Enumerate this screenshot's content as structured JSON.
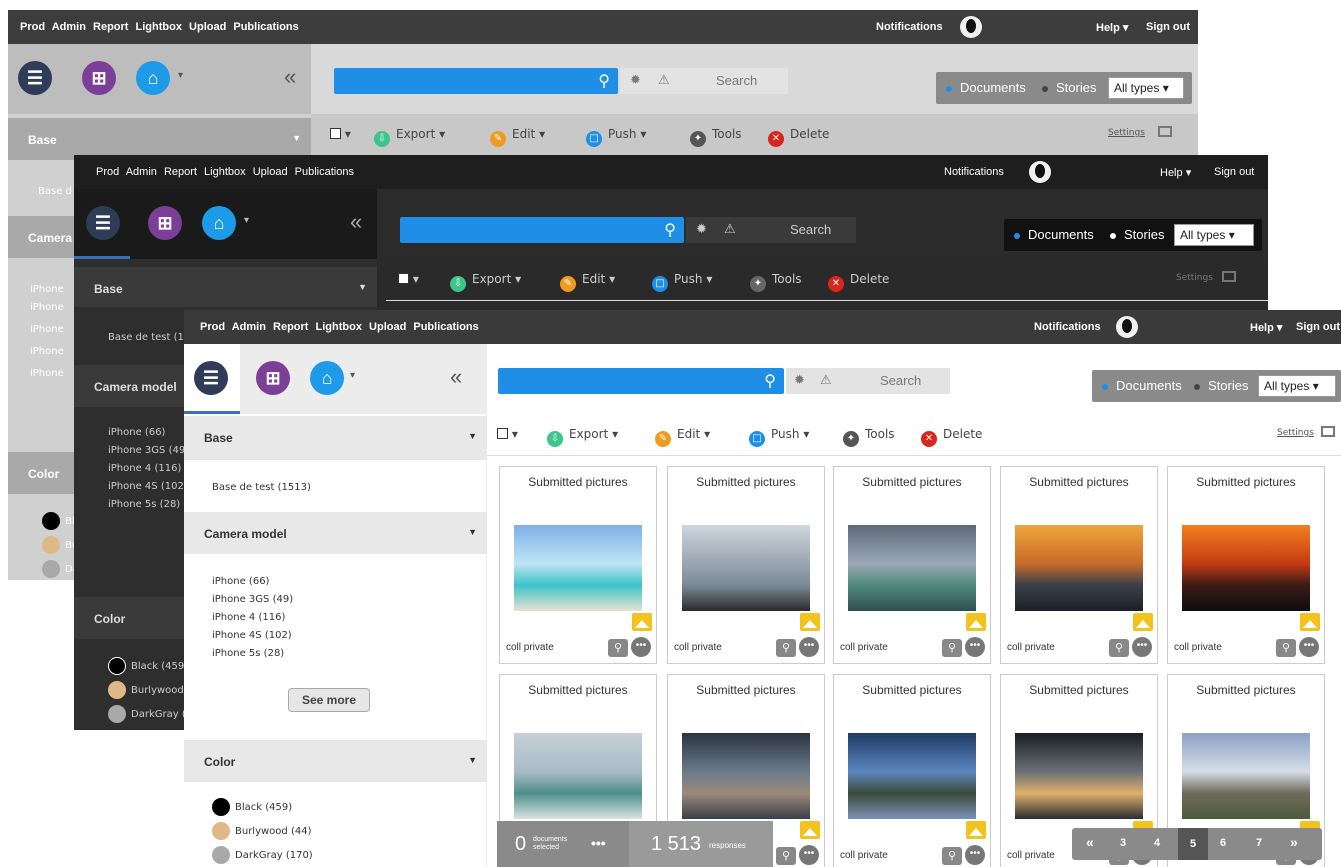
{
  "topbar": {
    "menu": [
      "Prod",
      "Admin",
      "Report",
      "Lightbox",
      "Upload",
      "Publications"
    ],
    "notifications": "Notifications",
    "help": "Help",
    "sign_out": "Sign out"
  },
  "header": {
    "collapse": "«",
    "search_button": "Search",
    "documents": "Documents",
    "stories": "Stories",
    "type_select": "All types"
  },
  "toolbar": {
    "export": "Export",
    "edit": "Edit",
    "push": "Push",
    "tools": "Tools",
    "delete": "Delete",
    "settings": "Settings"
  },
  "sidebar": {
    "base_title": "Base",
    "base_items": [
      "Base de test (1513)"
    ],
    "camera_title": "Camera model",
    "camera_items": [
      "iPhone (66)",
      "iPhone 3GS (49)",
      "iPhone 4 (116)",
      "iPhone 4S (102)",
      "iPhone 5s (28)"
    ],
    "see_more": "See more",
    "color_title": "Color",
    "color_items": [
      "Black (459)",
      "Burlywood (44)",
      "DarkGray (170)"
    ],
    "color_values": [
      "#000000",
      "#deb887",
      "#a9a9a9"
    ]
  },
  "back_window": {
    "base_short": "Base d",
    "camera_short": "Camera",
    "camera_items_short": [
      "iPhone",
      "iPhone",
      "iPhone",
      "iPhone",
      "iPhone"
    ],
    "color_short": [
      "Bl",
      "Bu",
      "Da"
    ]
  },
  "mid_window": {
    "base_item": "Base de test (15",
    "camera_items": [
      "iPhone (66)",
      "iPhone 3GS (49",
      "iPhone 4 (116)",
      "iPhone 4S (102",
      "iPhone 5s (28)"
    ],
    "color_items": [
      "Black (459)",
      "Burlywood",
      "DarkGray ("
    ]
  },
  "cards": {
    "title": "Submitted pictures",
    "collection": "coll private"
  },
  "status": {
    "selected_count": "0",
    "selected_label": "documents selected",
    "responses_count": "1 513",
    "responses_label": "responses"
  },
  "pager": {
    "first": "«",
    "pages": [
      "3",
      "4",
      "5",
      "6",
      "7"
    ],
    "current": "5",
    "last": "»"
  },
  "colors": {
    "accent": "#1e8ee6",
    "topbar": "#3d3d3d",
    "dark_theme": "#2a2a2a"
  }
}
